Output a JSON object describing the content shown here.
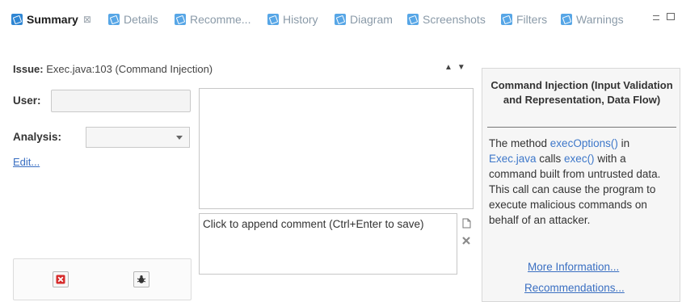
{
  "tabs": [
    {
      "label": "Summary",
      "active": true,
      "close": "⊠"
    },
    {
      "label": "Details"
    },
    {
      "label": "Recomme..."
    },
    {
      "label": "History"
    },
    {
      "label": "Diagram"
    },
    {
      "label": "Screenshots"
    },
    {
      "label": "Filters"
    },
    {
      "label": "Warnings"
    }
  ],
  "issue": {
    "label": "Issue:",
    "value": "Exec.java:103 (Command Injection)"
  },
  "form": {
    "user_label": "User:",
    "user_value": "",
    "analysis_label": "Analysis:",
    "analysis_value": "",
    "edit_link": "Edit..."
  },
  "comments": {
    "append_placeholder": "Click to append comment (Ctrl+Enter to save)"
  },
  "info": {
    "title": "Command Injection (Input Validation and Representation, Data Flow)",
    "body_1": "The method ",
    "body_link_1": "execOptions()",
    "body_2": " in ",
    "body_link_2": "Exec.java",
    "body_3": " calls ",
    "body_link_3": "exec()",
    "body_4": " with a command built from untrusted data. This call can cause the program to execute malicious commands on behalf of an attacker.",
    "more_info": "More Information...",
    "recommendations": "Recommendations..."
  },
  "colors": {
    "accent": "#2f86d3",
    "link": "#3a6fc2",
    "delete": "#d62a2a"
  },
  "icons": [
    "summary-tab-icon",
    "delete-icon",
    "bug-icon",
    "add-comment-icon",
    "remove-comment-icon",
    "up-arrow-icon",
    "down-arrow-icon"
  ]
}
